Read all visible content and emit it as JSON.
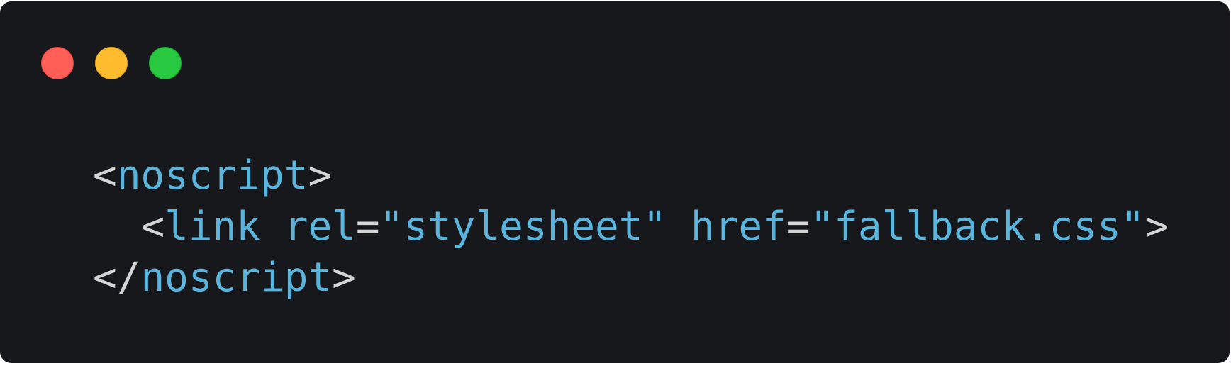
{
  "window": {
    "controls": [
      {
        "name": "close",
        "color": "#ff5f57"
      },
      {
        "name": "minimize",
        "color": "#febc2e"
      },
      {
        "name": "maximize",
        "color": "#28c840"
      }
    ]
  },
  "code": {
    "lines": [
      {
        "indent": "",
        "open": "<",
        "tag": "noscript",
        "close": ">"
      },
      {
        "indent": "  ",
        "open": "<",
        "tag": "link",
        "sp1": " ",
        "attr1": "rel",
        "eq1": "=",
        "val1": "\"stylesheet\"",
        "sp2": " ",
        "attr2": "href",
        "eq2": "=",
        "val2": "\"fallback.css\"",
        "close": ">"
      },
      {
        "indent": "",
        "open": "</",
        "tag": "noscript",
        "close": ">"
      }
    ]
  },
  "colors": {
    "background": "#16181b",
    "punctuation": "#d4d4d4",
    "token": "#5ab4dc"
  }
}
